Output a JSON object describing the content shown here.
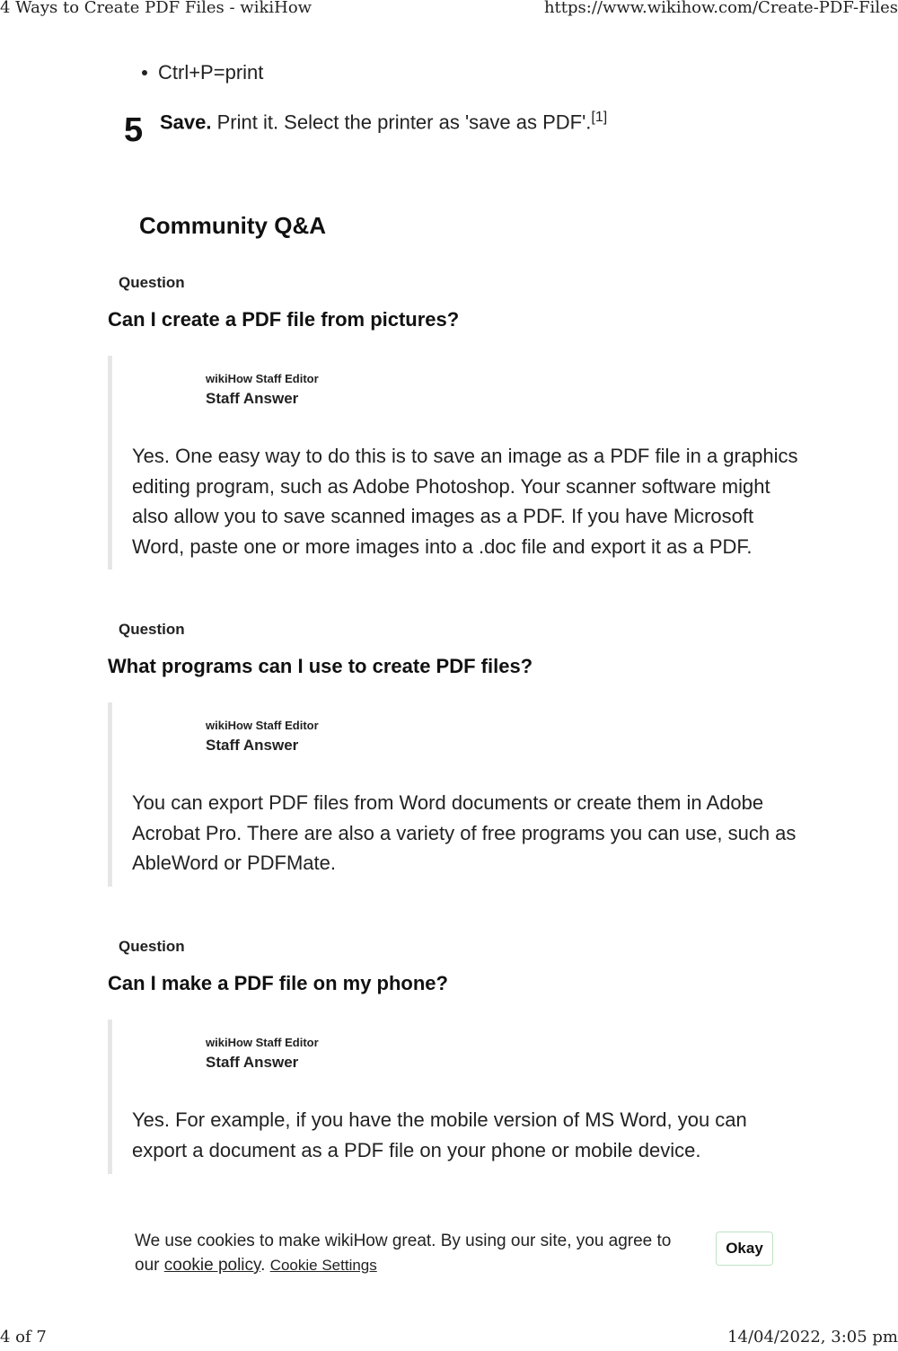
{
  "print_header": {
    "title": "4 Ways to Create PDF Files - wikiHow",
    "url": "https://www.wikihow.com/Create-PDF-Files"
  },
  "bullet": "Ctrl+P=print",
  "step": {
    "number": "5",
    "bold": "Save.",
    "text": " Print it. Select the printer as 'save as PDF'.",
    "ref": "[1]"
  },
  "qa_heading": "Community Q&A",
  "questions": [
    {
      "label": "Question",
      "question": "Can I create a PDF file from pictures?",
      "editor": "wikiHow Staff Editor",
      "staff": "Staff Answer",
      "answer": "Yes. One easy way to do this is to save an image as a PDF file in a graphics editing program, such as Adobe Photoshop. Your scanner software might also allow you to save scanned images as a PDF. If you have Microsoft Word, paste one or more images into a .doc file and export it as a PDF."
    },
    {
      "label": "Question",
      "question": "What programs can I use to create PDF files?",
      "editor": "wikiHow Staff Editor",
      "staff": "Staff Answer",
      "answer": "You can export PDF files from Word documents or create them in Adobe Acrobat Pro. There are also a variety of free programs you can use, such as AbleWord or PDFMate."
    },
    {
      "label": "Question",
      "question": "Can I make a PDF file on my phone?",
      "editor": "wikiHow Staff Editor",
      "staff": "Staff Answer",
      "answer": "Yes. For example, if you have the mobile version of MS Word, you can export a document as a PDF file on your phone or mobile device."
    }
  ],
  "cookie": {
    "text": "We use cookies to make wikiHow great. By using our site, you agree to our ",
    "policy_link": "cookie policy",
    "sep": ". ",
    "settings_link": "Cookie Settings",
    "okay": "Okay"
  },
  "print_footer": {
    "page": "4 of 7",
    "datetime": "14/04/2022, 3:05 pm"
  }
}
